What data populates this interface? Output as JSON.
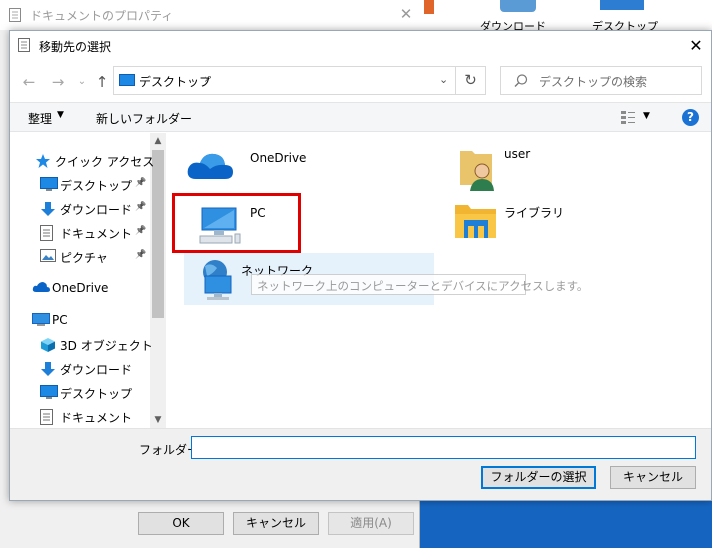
{
  "background_window": {
    "title": "ドキュメントのプロパティ",
    "buttons": {
      "ok": "OK",
      "cancel": "キャンセル",
      "apply": "適用(A)"
    }
  },
  "desktop": {
    "labels": [
      "ダウンロード",
      "デスクトップ"
    ]
  },
  "dialog": {
    "title": "移動先の選択",
    "address": {
      "path": "デスクトップ",
      "separator": "›"
    },
    "search": {
      "placeholder": "デスクトップの検索"
    },
    "toolbar": {
      "organize": "整理",
      "new_folder": "新しいフォルダー"
    },
    "nav": [
      {
        "label": "クイック アクセス",
        "icon": "star-icon",
        "pinned": false
      },
      {
        "label": "デスクトップ",
        "icon": "desktop-icon",
        "pinned": true
      },
      {
        "label": "ダウンロード",
        "icon": "download-icon",
        "pinned": true
      },
      {
        "label": "ドキュメント",
        "icon": "document-icon",
        "pinned": true
      },
      {
        "label": "ピクチャ",
        "icon": "picture-icon",
        "pinned": true
      },
      {
        "label": "OneDrive",
        "icon": "cloud-icon",
        "pinned": false
      },
      {
        "label": "PC",
        "icon": "pc-icon",
        "pinned": false
      },
      {
        "label": "3D オブジェクト",
        "icon": "cube-icon",
        "pinned": false
      },
      {
        "label": "ダウンロード",
        "icon": "download-icon",
        "pinned": false
      },
      {
        "label": "デスクトップ",
        "icon": "desktop-icon",
        "pinned": false
      },
      {
        "label": "ドキュメント",
        "icon": "document-icon",
        "pinned": false
      }
    ],
    "items": {
      "onedrive": "OneDrive",
      "user": "user",
      "pc": "PC",
      "library": "ライブラリ",
      "network": "ネットワーク"
    },
    "tooltip": "ネットワーク上のコンピューターとデバイスにアクセスします。",
    "folder_label": "フォルダー:",
    "folder_value": "",
    "buttons": {
      "select": "フォルダーの選択",
      "cancel": "キャンセル"
    },
    "highlight_color": "#e81123"
  }
}
